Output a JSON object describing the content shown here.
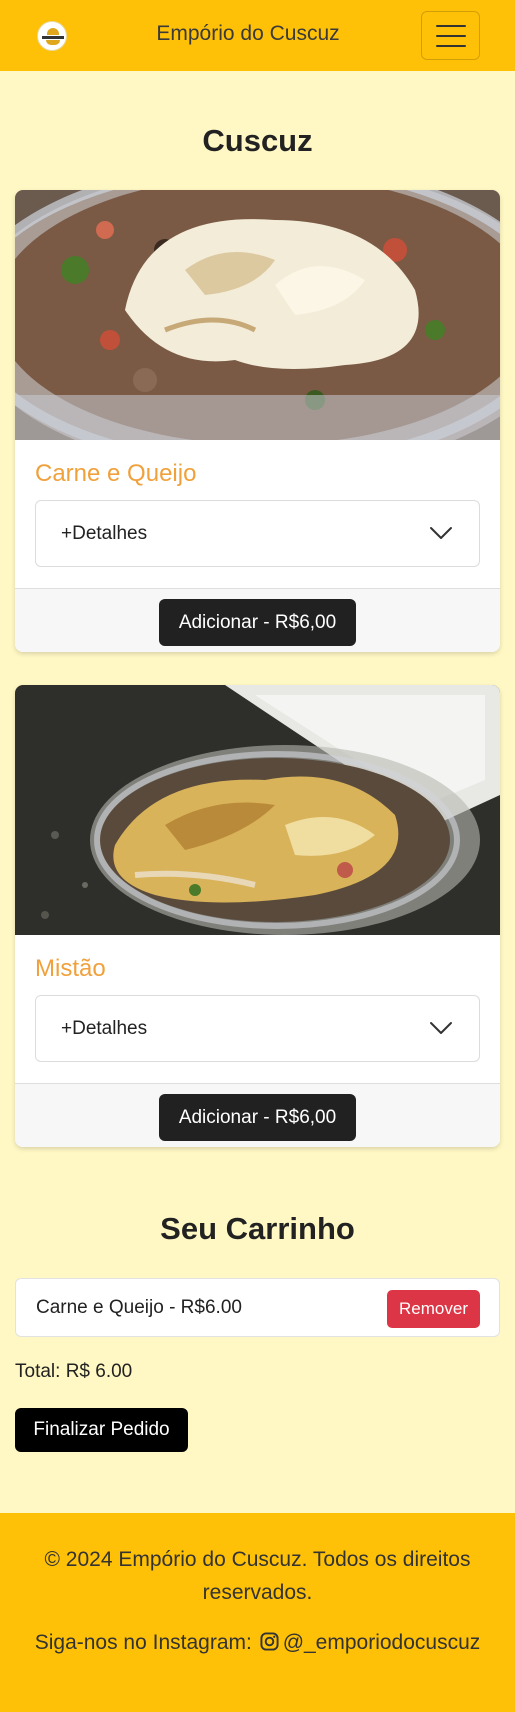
{
  "header": {
    "brand": "Empório do Cuscuz",
    "logo_icon": "cuscuz-logo-icon",
    "menu_icon": "hamburger-menu-icon"
  },
  "menu": {
    "section_title": "Cuscuz",
    "items": [
      {
        "name": "Carne e Queijo",
        "details_label": "+Detalhes",
        "add_label": "Adicionar - R$6,00",
        "image": "cuscuz com carne e queijo"
      },
      {
        "name": "Mistão",
        "details_label": "+Detalhes",
        "add_label": "Adicionar - R$6,00",
        "image": "cuscuz mistão"
      }
    ]
  },
  "cart": {
    "title": "Seu Carrinho",
    "items": [
      {
        "text": "Carne e Queijo - R$6.00",
        "remove_label": "Remover"
      }
    ],
    "total": "Total: R$ 6.00",
    "checkout_label": "Finalizar Pedido"
  },
  "footer": {
    "copyright": "© 2024 Empório do Cuscuz. Todos os direitos reservados.",
    "instagram_prefix": "Siga-nos no Instagram:",
    "instagram_handle": "@_emporiodocuscuz",
    "instagram_icon": "instagram-icon"
  },
  "colors": {
    "navbar": "#ffc107",
    "page_background": "#fff8c4",
    "item_name": "#f0a13c",
    "add_button": "#212121",
    "remove_button": "#dc3545",
    "checkout_button": "#000000"
  }
}
